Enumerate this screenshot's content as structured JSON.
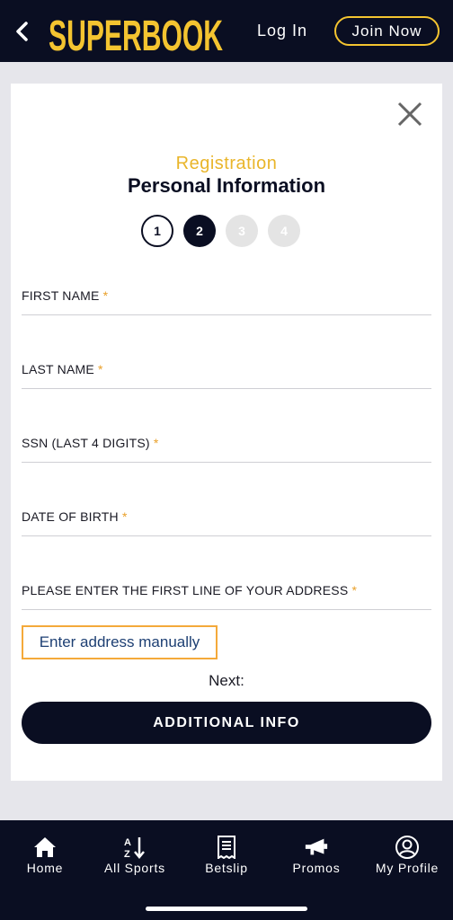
{
  "header": {
    "logo_text": "SUPERBOOK",
    "login_label": "Log In",
    "join_label": "Join Now"
  },
  "registration": {
    "subtitle": "Registration",
    "title": "Personal Information",
    "steps": [
      "1",
      "2",
      "3",
      "4"
    ],
    "current_step": 2
  },
  "form": {
    "fields": [
      {
        "label": "FIRST NAME",
        "required": "*"
      },
      {
        "label": "LAST NAME",
        "required": "*"
      },
      {
        "label": "SSN (LAST 4 DIGITS)",
        "required": "*"
      },
      {
        "label": "DATE OF BIRTH",
        "required": "*"
      },
      {
        "label": "PLEASE ENTER THE FIRST LINE OF YOUR ADDRESS",
        "required": "*"
      }
    ],
    "manual_address_label": "Enter address manually",
    "next_label": "Next:",
    "next_button_label": "ADDITIONAL INFO"
  },
  "nav": {
    "items": [
      {
        "label": "Home",
        "icon": "home-icon"
      },
      {
        "label": "All Sports",
        "icon": "az-sort-icon"
      },
      {
        "label": "Betslip",
        "icon": "receipt-icon"
      },
      {
        "label": "Promos",
        "icon": "megaphone-icon"
      },
      {
        "label": "My Profile",
        "icon": "profile-icon"
      }
    ]
  },
  "colors": {
    "navy": "#0a0e22",
    "gold": "#f4c430",
    "accent_orange": "#f4a93a"
  }
}
